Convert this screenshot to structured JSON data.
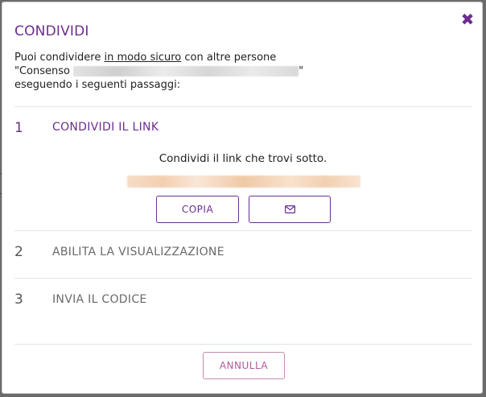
{
  "dialog": {
    "title": "CONDIVIDI",
    "close_icon": "close-icon"
  },
  "intro": {
    "line1_before": "Puoi condividere ",
    "line1_link": "in modo sicuro",
    "line1_after": " con altre persone",
    "line2_prefix": "\"Consenso",
    "line2_suffix": "\"",
    "line3": "eseguendo i seguenti passaggi:"
  },
  "steps": [
    {
      "number": "1",
      "label": "CONDIVIDI IL LINK"
    },
    {
      "number": "2",
      "label": "ABILITA LA VISUALIZZAZIONE"
    },
    {
      "number": "3",
      "label": "INVIA IL CODICE"
    }
  ],
  "step1": {
    "instruction": "Condividi il link che trovi sotto.",
    "copy_label": "COPIA",
    "email_icon": "envelope-icon"
  },
  "footer": {
    "cancel_label": "ANNULLA"
  },
  "colors": {
    "accent": "#6b2d8f",
    "cancel": "#b2599a"
  }
}
